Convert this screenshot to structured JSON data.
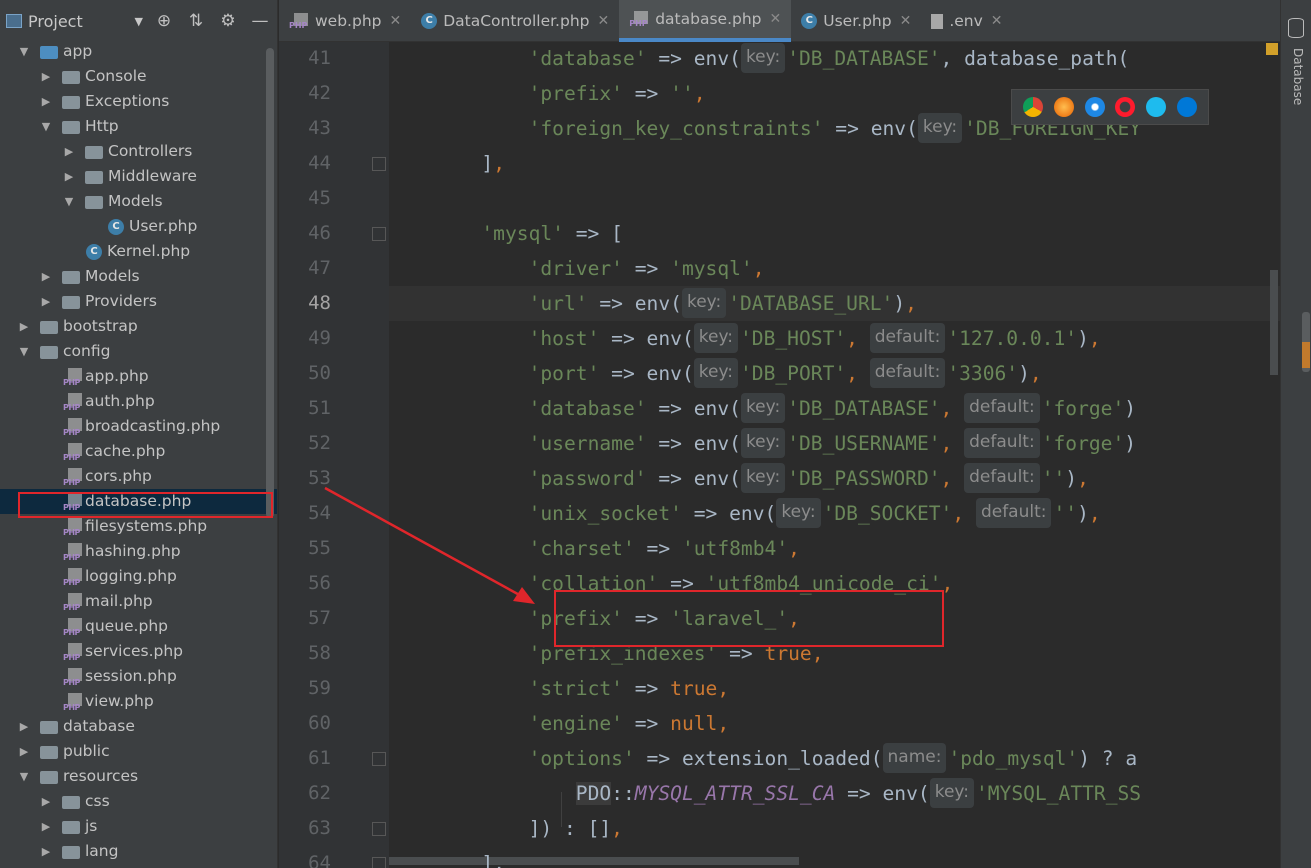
{
  "project_panel": {
    "title": "Project",
    "toolbar_icons": [
      "crosshair-icon",
      "collapse-icon",
      "gear-icon",
      "minimize-icon"
    ],
    "tree": [
      {
        "label": "app",
        "type": "folder",
        "open": true,
        "level": 1,
        "color": "blue"
      },
      {
        "label": "Console",
        "type": "folder",
        "open": false,
        "level": 2
      },
      {
        "label": "Exceptions",
        "type": "folder",
        "open": false,
        "level": 2
      },
      {
        "label": "Http",
        "type": "folder",
        "open": true,
        "level": 2
      },
      {
        "label": "Controllers",
        "type": "folder",
        "open": false,
        "level": 3
      },
      {
        "label": "Middleware",
        "type": "folder",
        "open": false,
        "level": 3
      },
      {
        "label": "Models",
        "type": "folder",
        "open": true,
        "level": 3
      },
      {
        "label": "User.php",
        "type": "class",
        "level": 4
      },
      {
        "label": "Kernel.php",
        "type": "class",
        "level": 3
      },
      {
        "label": "Models",
        "type": "folder",
        "open": false,
        "level": 2
      },
      {
        "label": "Providers",
        "type": "folder",
        "open": false,
        "level": 2
      },
      {
        "label": "bootstrap",
        "type": "folder",
        "open": false,
        "level": 1
      },
      {
        "label": "config",
        "type": "folder",
        "open": true,
        "level": 1
      },
      {
        "label": "app.php",
        "type": "php",
        "level": 3
      },
      {
        "label": "auth.php",
        "type": "php",
        "level": 3
      },
      {
        "label": "broadcasting.php",
        "type": "php",
        "level": 3
      },
      {
        "label": "cache.php",
        "type": "php",
        "level": 3
      },
      {
        "label": "cors.php",
        "type": "php",
        "level": 3
      },
      {
        "label": "database.php",
        "type": "php",
        "level": 3,
        "selected": true
      },
      {
        "label": "filesystems.php",
        "type": "php",
        "level": 3
      },
      {
        "label": "hashing.php",
        "type": "php",
        "level": 3
      },
      {
        "label": "logging.php",
        "type": "php",
        "level": 3
      },
      {
        "label": "mail.php",
        "type": "php",
        "level": 3
      },
      {
        "label": "queue.php",
        "type": "php",
        "level": 3
      },
      {
        "label": "services.php",
        "type": "php",
        "level": 3
      },
      {
        "label": "session.php",
        "type": "php",
        "level": 3
      },
      {
        "label": "view.php",
        "type": "php",
        "level": 3
      },
      {
        "label": "database",
        "type": "folder",
        "open": false,
        "level": 1
      },
      {
        "label": "public",
        "type": "folder",
        "open": false,
        "level": 1
      },
      {
        "label": "resources",
        "type": "folder",
        "open": true,
        "level": 1
      },
      {
        "label": "css",
        "type": "folder",
        "open": false,
        "level": 2
      },
      {
        "label": "js",
        "type": "folder",
        "open": false,
        "level": 2
      },
      {
        "label": "lang",
        "type": "folder",
        "open": false,
        "level": 2
      }
    ]
  },
  "tabs": [
    {
      "label": "web.php",
      "icon": "php",
      "active": false
    },
    {
      "label": "DataController.php",
      "icon": "class",
      "active": false
    },
    {
      "label": "database.php",
      "icon": "php",
      "active": true
    },
    {
      "label": "User.php",
      "icon": "class",
      "active": false
    },
    {
      "label": ".env",
      "icon": "env",
      "active": false
    }
  ],
  "right_tool": {
    "label": "Database"
  },
  "browser_icons": [
    "chrome-icon",
    "firefox-icon",
    "safari-icon",
    "opera-icon",
    "ie-icon",
    "edge-icon"
  ],
  "editor": {
    "current_line": 48,
    "lines": [
      {
        "n": 41,
        "fold": false,
        "indent": 12,
        "parts": [
          [
            "s",
            "'database'"
          ],
          [
            "p",
            " => env("
          ],
          [
            "h",
            "key:"
          ],
          [
            "s",
            "'DB_DATABASE'"
          ],
          [
            "p",
            ", database_path("
          ]
        ]
      },
      {
        "n": 42,
        "fold": false,
        "indent": 12,
        "parts": [
          [
            "s",
            "'prefix'"
          ],
          [
            "p",
            " => "
          ],
          [
            "s",
            "''"
          ],
          [
            "k",
            ","
          ]
        ]
      },
      {
        "n": 43,
        "fold": false,
        "indent": 12,
        "parts": [
          [
            "s",
            "'foreign_key_constraints'"
          ],
          [
            "p",
            " => env("
          ],
          [
            "h",
            "key:"
          ],
          [
            "s",
            "'DB_FOREIGN_KEY"
          ]
        ]
      },
      {
        "n": 44,
        "fold": true,
        "indent": 8,
        "parts": [
          [
            "p",
            "]"
          ],
          [
            "k",
            ","
          ]
        ]
      },
      {
        "n": 45,
        "fold": false,
        "indent": 0,
        "parts": []
      },
      {
        "n": 46,
        "fold": true,
        "indent": 8,
        "parts": [
          [
            "s",
            "'mysql'"
          ],
          [
            "p",
            " => ["
          ]
        ]
      },
      {
        "n": 47,
        "fold": false,
        "indent": 12,
        "parts": [
          [
            "s",
            "'driver'"
          ],
          [
            "p",
            " => "
          ],
          [
            "s",
            "'mysql'"
          ],
          [
            "k",
            ","
          ]
        ]
      },
      {
        "n": 48,
        "fold": false,
        "indent": 12,
        "parts": [
          [
            "s",
            "'url'"
          ],
          [
            "p",
            " => env("
          ],
          [
            "h",
            "key:"
          ],
          [
            "s",
            "'DATABASE_URL'"
          ],
          [
            "p",
            ")"
          ],
          [
            "k",
            ","
          ]
        ]
      },
      {
        "n": 49,
        "fold": false,
        "indent": 12,
        "parts": [
          [
            "s",
            "'host'"
          ],
          [
            "p",
            " => env("
          ],
          [
            "h",
            "key:"
          ],
          [
            "s",
            "'DB_HOST'"
          ],
          [
            "k",
            ", "
          ],
          [
            "h",
            "default:"
          ],
          [
            "s",
            "'127.0.0.1'"
          ],
          [
            "p",
            ")"
          ],
          [
            "k",
            ","
          ]
        ]
      },
      {
        "n": 50,
        "fold": false,
        "indent": 12,
        "parts": [
          [
            "s",
            "'port'"
          ],
          [
            "p",
            " => env("
          ],
          [
            "h",
            "key:"
          ],
          [
            "s",
            "'DB_PORT'"
          ],
          [
            "k",
            ", "
          ],
          [
            "h",
            "default:"
          ],
          [
            "s",
            "'3306'"
          ],
          [
            "p",
            ")"
          ],
          [
            "k",
            ","
          ]
        ]
      },
      {
        "n": 51,
        "fold": false,
        "indent": 12,
        "parts": [
          [
            "s",
            "'database'"
          ],
          [
            "p",
            " => env("
          ],
          [
            "h",
            "key:"
          ],
          [
            "s",
            "'DB_DATABASE'"
          ],
          [
            "k",
            ", "
          ],
          [
            "h",
            "default:"
          ],
          [
            "s",
            "'forge'"
          ],
          [
            "p",
            ")"
          ]
        ]
      },
      {
        "n": 52,
        "fold": false,
        "indent": 12,
        "parts": [
          [
            "s",
            "'username'"
          ],
          [
            "p",
            " => env("
          ],
          [
            "h",
            "key:"
          ],
          [
            "s",
            "'DB_USERNAME'"
          ],
          [
            "k",
            ", "
          ],
          [
            "h",
            "default:"
          ],
          [
            "s",
            "'forge'"
          ],
          [
            "p",
            ")"
          ]
        ]
      },
      {
        "n": 53,
        "fold": false,
        "indent": 12,
        "parts": [
          [
            "s",
            "'password'"
          ],
          [
            "p",
            " => env("
          ],
          [
            "h",
            "key:"
          ],
          [
            "s",
            "'DB_PASSWORD'"
          ],
          [
            "k",
            ", "
          ],
          [
            "h",
            "default:"
          ],
          [
            "s",
            "''"
          ],
          [
            "p",
            ")"
          ],
          [
            "k",
            ","
          ]
        ]
      },
      {
        "n": 54,
        "fold": false,
        "indent": 12,
        "parts": [
          [
            "s",
            "'unix_socket'"
          ],
          [
            "p",
            " => env("
          ],
          [
            "h",
            "key:"
          ],
          [
            "s",
            "'DB_SOCKET'"
          ],
          [
            "k",
            ", "
          ],
          [
            "h",
            "default:"
          ],
          [
            "s",
            "''"
          ],
          [
            "p",
            ")"
          ],
          [
            "k",
            ","
          ]
        ]
      },
      {
        "n": 55,
        "fold": false,
        "indent": 12,
        "parts": [
          [
            "s",
            "'charset'"
          ],
          [
            "p",
            " => "
          ],
          [
            "s",
            "'utf8mb4'"
          ],
          [
            "k",
            ","
          ]
        ]
      },
      {
        "n": 56,
        "fold": false,
        "indent": 12,
        "parts": [
          [
            "s",
            "'collation'"
          ],
          [
            "p",
            " => "
          ],
          [
            "s",
            "'utf8mb4_unicode_ci'"
          ],
          [
            "k",
            ","
          ]
        ]
      },
      {
        "n": 57,
        "fold": false,
        "indent": 12,
        "parts": [
          [
            "s",
            "'prefix'"
          ],
          [
            "p",
            " => "
          ],
          [
            "s",
            "'laravel_'"
          ],
          [
            "k",
            ","
          ]
        ]
      },
      {
        "n": 58,
        "fold": false,
        "indent": 12,
        "parts": [
          [
            "s",
            "'prefix_indexes'"
          ],
          [
            "p",
            " => "
          ],
          [
            "k",
            "true,"
          ]
        ]
      },
      {
        "n": 59,
        "fold": false,
        "indent": 12,
        "parts": [
          [
            "s",
            "'strict'"
          ],
          [
            "p",
            " => "
          ],
          [
            "k",
            "true,"
          ]
        ]
      },
      {
        "n": 60,
        "fold": false,
        "indent": 12,
        "parts": [
          [
            "s",
            "'engine'"
          ],
          [
            "p",
            " => "
          ],
          [
            "k",
            "null,"
          ]
        ]
      },
      {
        "n": 61,
        "fold": true,
        "indent": 12,
        "parts": [
          [
            "s",
            "'options'"
          ],
          [
            "p",
            " => extension_loaded("
          ],
          [
            "h",
            "name:"
          ],
          [
            "s",
            "'pdo_mysql'"
          ],
          [
            "p",
            ") ? a"
          ]
        ]
      },
      {
        "n": 62,
        "fold": false,
        "indent": 16,
        "parts": [
          [
            "c",
            "PDO"
          ],
          [
            "p",
            "::"
          ],
          [
            "i",
            "MYSQL_ATTR_SSL_CA"
          ],
          [
            "p",
            " => env("
          ],
          [
            "h",
            "key:"
          ],
          [
            "s",
            "'MYSQL_ATTR_SS"
          ]
        ]
      },
      {
        "n": 63,
        "fold": true,
        "indent": 12,
        "parts": [
          [
            "p",
            "]) : []"
          ],
          [
            "k",
            ","
          ]
        ]
      },
      {
        "n": 64,
        "fold": true,
        "indent": 8,
        "parts": [
          [
            "p",
            "],"
          ]
        ]
      }
    ]
  }
}
